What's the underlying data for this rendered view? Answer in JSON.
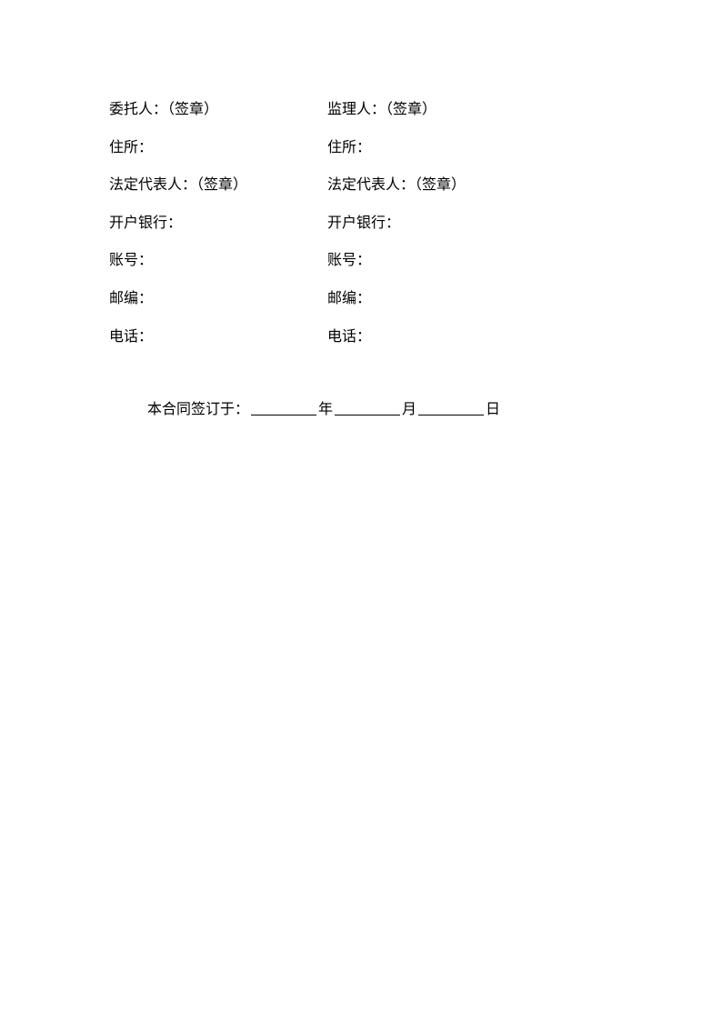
{
  "left": {
    "party": "委托人：（签章）",
    "address": "住所：",
    "legal_rep": "法定代表人：（签章）",
    "bank": "开户银行：",
    "account": "账号：",
    "postcode": "邮编：",
    "phone": "电话："
  },
  "right": {
    "party": "监理人：（签章）",
    "address": "住所：",
    "legal_rep": "法定代表人：（签章）",
    "bank": "开户银行：",
    "account": "账号：",
    "postcode": "邮编：",
    "phone": "电话："
  },
  "date_line": {
    "prefix": "本合同签订于：",
    "year": "年",
    "month": "月",
    "day": "日"
  }
}
